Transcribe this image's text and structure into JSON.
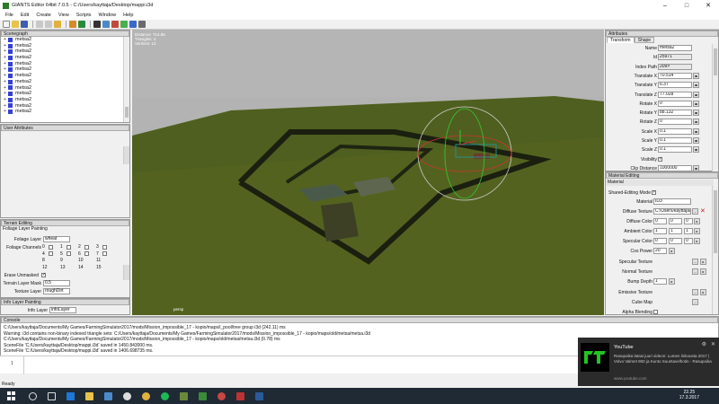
{
  "window": {
    "title": "GIANTS Editor 64bit 7.0.5 - C:/Users/kayttaja/Desktop/mappi.i3d"
  },
  "menu": [
    "File",
    "Edit",
    "Create",
    "View",
    "Scripts",
    "Window",
    "Help"
  ],
  "scenegraph": {
    "title": "Scenegraph",
    "items": [
      "metsa2",
      "metsa2",
      "metsa2",
      "metsa2",
      "metsa2",
      "metsa2",
      "metsa2",
      "metsa2",
      "metsa2",
      "metsa2",
      "metsa2",
      "metsa2",
      "metsa2"
    ]
  },
  "user_attributes": {
    "title": "User Attributes"
  },
  "terrain_editing": {
    "title": "Terrain Editing",
    "subtitle": "Foliage Layer Painting",
    "foliage_layer_label": "Foliage Layer",
    "foliage_layer_value": "wheat",
    "foliage_channels_label": "Foliage Channels",
    "channels": [
      "0",
      "1",
      "2",
      "3",
      "4",
      "5",
      "6",
      "7",
      "8",
      "9",
      "10",
      "11",
      "12",
      "13",
      "14",
      "15"
    ],
    "erase_unmasked_label": "Erase Unmasked",
    "terrain_layer_mask_label": "Terrain Layer Mask",
    "terrain_layer_mask_value": "0.5",
    "texture_layer_label": "Texture Layer",
    "texture_layer_value": "roughDirt"
  },
  "info_layer": {
    "title": "Info Layer Painting",
    "label": "Info Layer",
    "value": "infoLayer"
  },
  "viewport": {
    "stats": [
      "Distance: 714.86",
      "Triangles: 4",
      "Vertices: 12"
    ],
    "camera": "persp"
  },
  "attributes": {
    "title": "Attributes",
    "tabs": [
      "Transform",
      "Shape"
    ],
    "rows": [
      {
        "label": "Name",
        "value": "metsa2"
      },
      {
        "label": "Id",
        "value": "25971",
        "readonly": true
      },
      {
        "label": "Index Path",
        "value": "209>",
        "readonly": true
      },
      {
        "label": "Translate X",
        "value": "70.514"
      },
      {
        "label": "Translate Y",
        "value": "6.37"
      },
      {
        "label": "Translate Z",
        "value": "77.028"
      },
      {
        "label": "Rotate X",
        "value": "0"
      },
      {
        "label": "Rotate Y",
        "value": "88.132"
      },
      {
        "label": "Rotate Z",
        "value": "0"
      },
      {
        "label": "Scale X",
        "value": "0.1"
      },
      {
        "label": "Scale Y",
        "value": "0.1"
      },
      {
        "label": "Scale Z",
        "value": "0.1"
      },
      {
        "label": "Visibility",
        "value": ""
      },
      {
        "label": "Clip Distance",
        "value": "1000000"
      }
    ]
  },
  "material_editing": {
    "title": "Material Editing",
    "section": "Material",
    "shared_label": "Shared-Editing Mode",
    "material_label": "Material",
    "material_value": "ID3",
    "diffuse_texture_label": "Diffuse Texture",
    "diffuse_texture_value": "C:/Users/kayttaja/D",
    "diffuse_color_label": "Diffuse Color",
    "diffuse_color": [
      "0",
      "0",
      "0"
    ],
    "ambient_color_label": "Ambient Color",
    "ambient_color": [
      "1",
      "1",
      "1"
    ],
    "specular_color_label": "Specular Color",
    "specular_color": [
      "0",
      "0",
      "0"
    ],
    "cos_power_label": "Cos Power",
    "cos_power_value": "20",
    "specular_texture_label": "Specular Texture",
    "normal_texture_label": "Normal Texture",
    "bump_depth_label": "Bump Depth",
    "bump_depth_value": "1",
    "emissive_texture_label": "Emissive Texture",
    "cube_map_label": "Cube Map",
    "alpha_blending_label": "Alpha Blending"
  },
  "console": {
    "title": "Console",
    "lines": [
      "C:/Users/kayttaja/Documents/My Games/FarmingSimulator2017/mods/Mission_impossible_17 - kopio/maps/i_pool/tree group i3d (242.11) ms",
      "Warning: i3d contains non-binary indexed triangle sets: C:/Users/kayttaja/Documents/My Games/FarmingSimulator2017/mods/Mission_impossible_17 - kopio/maps/old/metsa/metsa.i3d",
      "C:/Users/kayttaja/Documents/My Games/FarmingSimulator2017/mods/Mission_impossible_17 - kopio/maps/old/metsa/metsa.i3d (0.78) ms",
      "SceneFile 'C:/Users/kayttaja/Desktop/mappi.i3d' saved in 1450.843000 ms.",
      "SceneFile 'C:/Users/kayttaja/Desktop/mappi.i3d' saved in 1406.698735 ms."
    ],
    "prompt": "1"
  },
  "status": {
    "text": "Ready",
    "right": "NavSpeed: 10 %"
  },
  "toast": {
    "title": "YouTube",
    "body": "Rasupoika latasi juuri videon: Lumen linkousta 2017 | Volvo Valmet 900 ja Kunto Suuntavelhotin - Rasupoika",
    "source": "www.youtube.com"
  },
  "clock": {
    "time": "22.25",
    "date": "17.3.2017"
  }
}
